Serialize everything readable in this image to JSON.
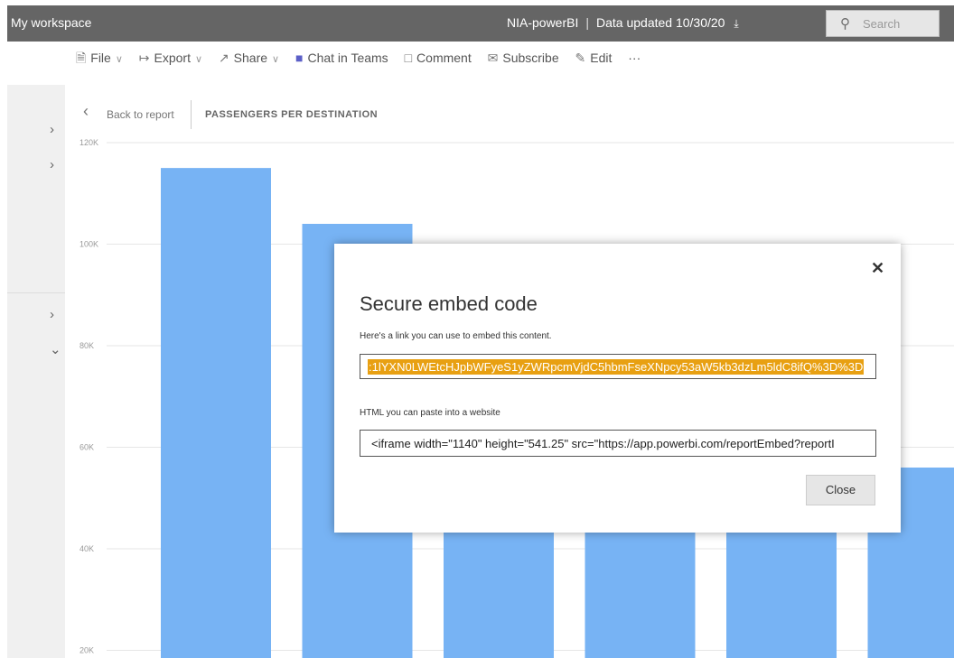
{
  "header": {
    "workspace": "My workspace",
    "report_name": "NIA-powerBI",
    "data_updated": "Data updated 10/30/20",
    "search_placeholder": "Search"
  },
  "toolbar": {
    "file": "File",
    "export": "Export",
    "share": "Share",
    "chat": "Chat in Teams",
    "comment": "Comment",
    "subscribe": "Subscribe",
    "edit": "Edit",
    "more": "···"
  },
  "nav": {
    "back_label": "Back to report",
    "visual_title": "PASSENGERS PER DESTINATION"
  },
  "chart_data": {
    "type": "bar",
    "ytick_labels": [
      "120K",
      "100K",
      "80K",
      "60K",
      "40K",
      "20K"
    ],
    "values": [
      115000,
      104000,
      91000,
      91000,
      91000,
      56000
    ],
    "ylim": [
      20000,
      120000
    ],
    "bar_color": "#77b3f4",
    "grid": true
  },
  "dialog": {
    "title": "Secure embed code",
    "link_label": "Here's a link you can use to embed this content.",
    "link_value": ":1lYXN0LWEtcHJpbWFyeS1yZWRpcmVjdC5hbmFseXNpcy53aW5kb3dzLm5ldC8ifQ%3D%3D",
    "html_label": "HTML you can paste into a website",
    "html_value": "<iframe width=\"1140\" height=\"541.25\" src=\"https://app.powerbi.com/reportEmbed?reportI",
    "close_button": "Close",
    "close_icon": "✕",
    "highlight_color": "#e8a012"
  }
}
